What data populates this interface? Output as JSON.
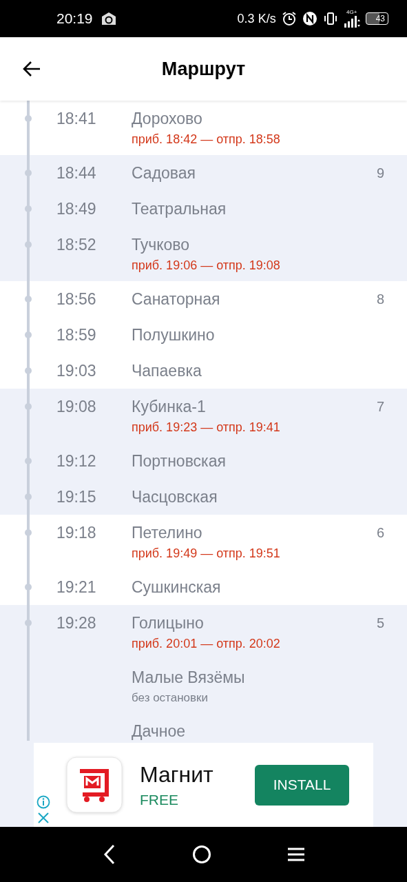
{
  "status_bar": {
    "time": "20:19",
    "speed": "0.3 K/s",
    "network": "4G+",
    "battery": "43"
  },
  "header": {
    "title": "Маршрут"
  },
  "zones": [
    {
      "stops": [
        {
          "time": "18:41",
          "name": "Дорохово",
          "note": "приб. 18:42 — отпр. 18:58",
          "kind": "stop"
        }
      ]
    },
    {
      "zone": "9",
      "stops": [
        {
          "time": "18:44",
          "name": "Садовая"
        },
        {
          "time": "18:49",
          "name": "Театральная"
        },
        {
          "time": "18:52",
          "name": "Тучково",
          "note": "приб. 19:06 — отпр. 19:08",
          "kind": "stop"
        }
      ]
    },
    {
      "zone": "8",
      "stops": [
        {
          "time": "18:56",
          "name": "Санаторная"
        },
        {
          "time": "18:59",
          "name": "Полушкино"
        },
        {
          "time": "19:03",
          "name": "Чапаевка"
        }
      ]
    },
    {
      "zone": "7",
      "stops": [
        {
          "time": "19:08",
          "name": "Кубинка-1",
          "note": "приб. 19:23 — отпр. 19:41",
          "kind": "stop"
        },
        {
          "time": "19:12",
          "name": "Портновская"
        },
        {
          "time": "19:15",
          "name": "Часцовская"
        }
      ]
    },
    {
      "zone": "6",
      "stops": [
        {
          "time": "19:18",
          "name": "Петелино",
          "note": "приб. 19:49 — отпр. 19:51",
          "kind": "stop"
        },
        {
          "time": "19:21",
          "name": "Сушкинская"
        }
      ]
    },
    {
      "zone": "5",
      "stops": [
        {
          "time": "19:28",
          "name": "Голицыно",
          "note": "приб. 20:01 — отпр. 20:02",
          "kind": "stop"
        },
        {
          "name": "Малые Вязёмы",
          "note": "без остановки",
          "kind": "pass"
        },
        {
          "name": "Дачное"
        }
      ]
    }
  ],
  "ad": {
    "app_name": "Магнит",
    "price": "FREE",
    "button": "INSTALL"
  }
}
